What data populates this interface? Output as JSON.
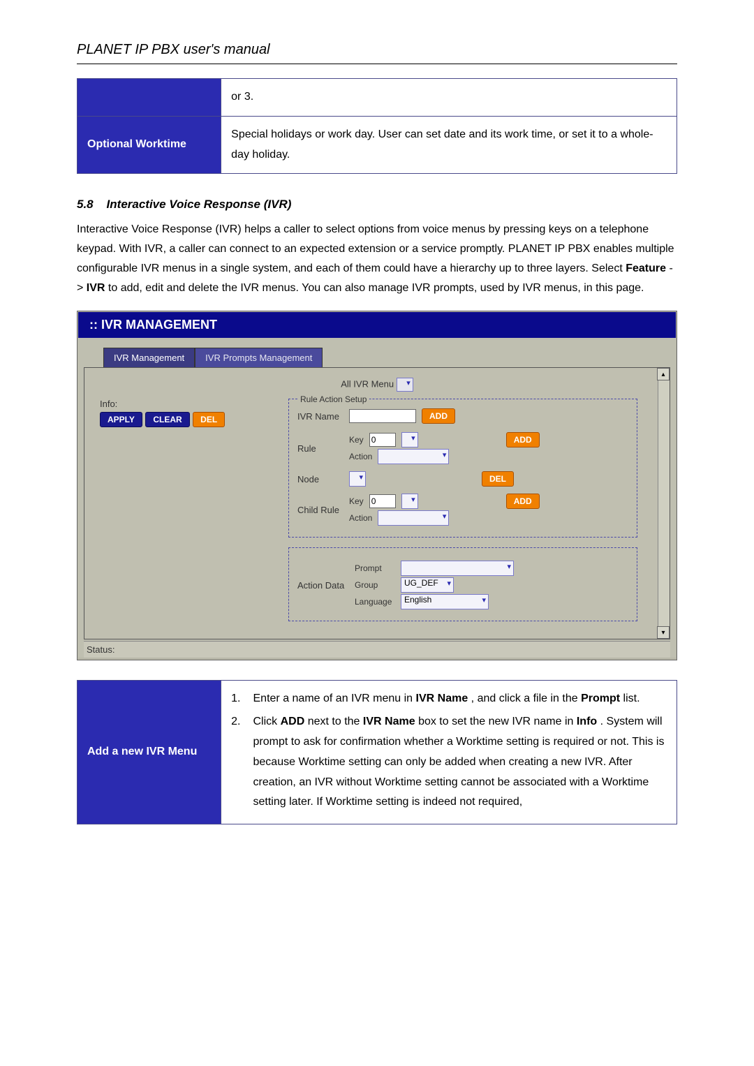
{
  "doc": {
    "title": "PLANET IP PBX user's manual"
  },
  "table1": {
    "row1": {
      "cell": "or 3."
    },
    "row2": {
      "header": "Optional Worktime",
      "cell": "Special holidays or work day. User can set date and its work time, or set it to a whole-day holiday."
    }
  },
  "section": {
    "number": "5.8",
    "title": "Interactive Voice Response (IVR)",
    "para_parts": [
      "Interactive Voice Response (IVR) helps a caller to select options from voice menus by pressing keys on a telephone keypad. With IVR, a caller can connect to an expected extension or a service promptly. PLANET IP PBX enables multiple configurable IVR menus in a single system, and each of them could have a hierarchy up to three layers. Select ",
      "Feature",
      " -> ",
      "IVR",
      " to add, edit and delete the IVR menus. You can also manage IVR prompts, used by IVR menus, in this page."
    ]
  },
  "screenshot": {
    "header": ":: IVR MANAGEMENT",
    "tabs": [
      "IVR Management",
      "IVR Prompts Management"
    ],
    "all_ivr_label": "All IVR Menu",
    "info_label": "Info:",
    "buttons": {
      "apply": "APPLY",
      "clear": "CLEAR",
      "del": "DEL",
      "add": "ADD"
    },
    "rule_action_legend": "Rule Action Setup",
    "labels": {
      "ivr_name": "IVR Name",
      "rule": "Rule",
      "key": "Key",
      "action": "Action",
      "node": "Node",
      "child_rule": "Child Rule",
      "action_data": "Action Data",
      "prompt": "Prompt",
      "group": "Group",
      "language": "Language"
    },
    "values": {
      "key1": "0",
      "key2": "0",
      "group": "UG_DEF",
      "language": "English"
    },
    "status": "Status:"
  },
  "table2": {
    "header": "Add a new IVR Menu",
    "steps": {
      "s1_num": "1.",
      "s1_parts": [
        "Enter a name of an IVR menu in ",
        "IVR Name",
        ", and click a file in the ",
        "Prompt",
        " list."
      ],
      "s2_num": "2.",
      "s2_parts": [
        "Click ",
        "ADD",
        " next to the ",
        "IVR Name",
        " box to set the new IVR name in ",
        "Info",
        ". System will prompt to ask for confirmation whether a Worktime setting is required or not. This is because Worktime setting can only be added when creating a new IVR. After creation, an IVR without Worktime setting cannot be associated with a Worktime setting later. If Worktime setting is indeed not required,"
      ]
    }
  }
}
